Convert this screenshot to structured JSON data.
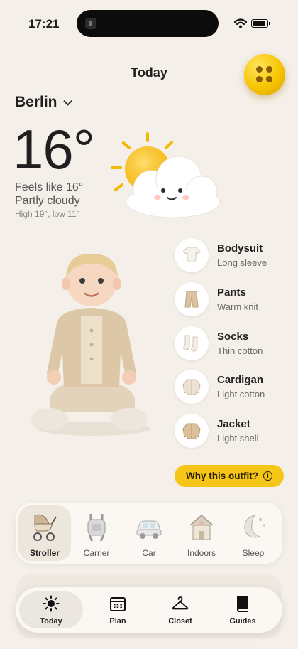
{
  "status_bar": {
    "time": "17:21"
  },
  "header": {
    "title": "Today"
  },
  "weather": {
    "location": "Berlin",
    "temperature": "16°",
    "feels_like": "Feels like 16°",
    "condition": "Partly cloudy",
    "high_low": "High 19°, low 11°"
  },
  "outfit": {
    "items": [
      {
        "name": "Bodysuit",
        "detail": "Long sleeve",
        "icon": "bodysuit-icon"
      },
      {
        "name": "Pants",
        "detail": "Warm knit",
        "icon": "pants-icon"
      },
      {
        "name": "Socks",
        "detail": "Thin cotton",
        "icon": "socks-icon"
      },
      {
        "name": "Cardigan",
        "detail": "Light cotton",
        "icon": "cardigan-icon"
      },
      {
        "name": "Jacket",
        "detail": "Light shell",
        "icon": "jacket-icon"
      }
    ],
    "why_button": "Why this outfit?"
  },
  "context": {
    "items": [
      {
        "label": "Stroller",
        "icon": "stroller-icon",
        "active": true
      },
      {
        "label": "Carrier",
        "icon": "carrier-icon",
        "active": false
      },
      {
        "label": "Car",
        "icon": "car-icon",
        "active": false
      },
      {
        "label": "Indoors",
        "icon": "house-icon",
        "active": false
      },
      {
        "label": "Sleep",
        "icon": "moon-icon",
        "active": false
      }
    ]
  },
  "tabs": [
    {
      "label": "Today",
      "icon": "sun-icon",
      "active": true
    },
    {
      "label": "Plan",
      "icon": "calendar-icon",
      "active": false
    },
    {
      "label": "Closet",
      "icon": "hanger-icon",
      "active": false
    },
    {
      "label": "Guides",
      "icon": "book-icon",
      "active": false
    }
  ],
  "colors": {
    "background": "#f4efe8",
    "accent": "#f5c518",
    "text": "#1f1f1f"
  }
}
